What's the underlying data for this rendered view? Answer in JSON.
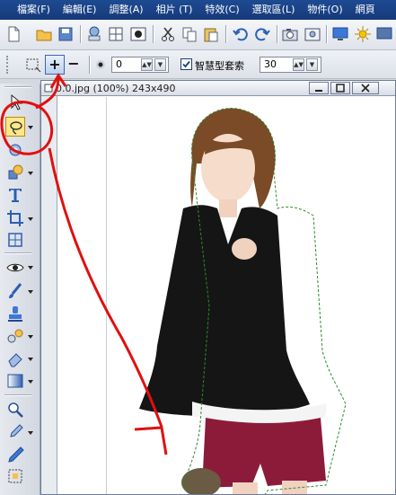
{
  "menu": {
    "items": [
      "檔案(F)",
      "編輯(E)",
      "調整(A)",
      "相片 (T)",
      "特效(C)",
      "選取區(L)",
      "物件(O)",
      "網頁"
    ]
  },
  "toolbar": {
    "icons": [
      "new-file-icon",
      "open-folder-icon",
      "save-icon",
      "print-icon",
      "grid-icon",
      "photo-icon",
      "cut-icon",
      "copy-icon",
      "paste-icon",
      "undo-icon",
      "redo-icon",
      "camera-icon",
      "scanner-icon",
      "monitor-icon",
      "sun-icon",
      "display-icon"
    ]
  },
  "options": {
    "add_label": "+",
    "subtract_label": "−",
    "feather_value": "0",
    "smart_checkbox_label": "智慧型套索",
    "smart_checked": true,
    "tolerance_value": "30"
  },
  "document": {
    "title": "0.0.jpg (100%) 243x490"
  },
  "palette": {
    "tools": [
      "pointer-icon",
      "lasso-icon",
      "magic-wand-icon",
      "shapes-icon",
      "text-icon",
      "crop-icon",
      "transform-icon",
      "eye-icon",
      "brush-icon",
      "stamp-icon",
      "retouch-icon",
      "eraser-icon",
      "gradient-icon",
      "zoom-icon",
      "eyedropper-icon",
      "pen-icon",
      "select-area-icon"
    ]
  },
  "colors": {
    "menubar": "#1e4a92",
    "annotation": "#e01010",
    "selection_marquee": "#2e8b2e"
  }
}
